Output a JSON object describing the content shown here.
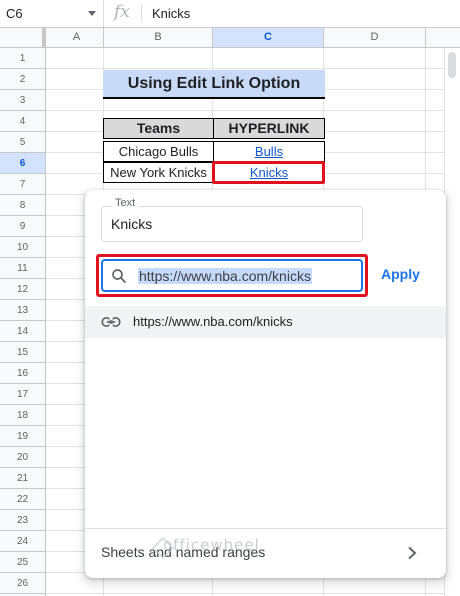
{
  "formula_bar": {
    "cell_ref": "C6",
    "fx_symbol": "fx",
    "content": "Knicks"
  },
  "columns": [
    "A",
    "B",
    "C",
    "D"
  ],
  "selected_column": "C",
  "rows": [
    "1",
    "2",
    "3",
    "4",
    "5",
    "6",
    "7",
    "8",
    "9",
    "10",
    "11",
    "12",
    "13",
    "14",
    "15",
    "16",
    "17",
    "18",
    "19",
    "20",
    "21",
    "22",
    "23",
    "24",
    "25",
    "26"
  ],
  "selected_row": "6",
  "sheet": {
    "title": "Using Edit Link Option",
    "table": {
      "headers": [
        "Teams",
        "HYPERLINK"
      ],
      "rows": [
        {
          "team": "Chicago Bulls",
          "link": "Bulls"
        },
        {
          "team": "New York Knicks",
          "link": "Knicks"
        }
      ]
    }
  },
  "link_popup": {
    "text_label": "Text",
    "text_value": "Knicks",
    "url_value": "https://www.nba.com/knicks",
    "apply_label": "Apply",
    "suggestion": "https://www.nba.com/knicks",
    "footer_label": "Sheets and named ranges",
    "watermark": "officewheel"
  },
  "colors": {
    "accent": "#1a73e8",
    "highlight_box": "#e0101e",
    "title_fill": "#c9daf8",
    "header_fill": "#d9d9d9",
    "link": "#1155cc"
  },
  "icons": [
    "search-icon",
    "link-icon",
    "chevron-right-icon",
    "dropdown-caret-icon"
  ]
}
